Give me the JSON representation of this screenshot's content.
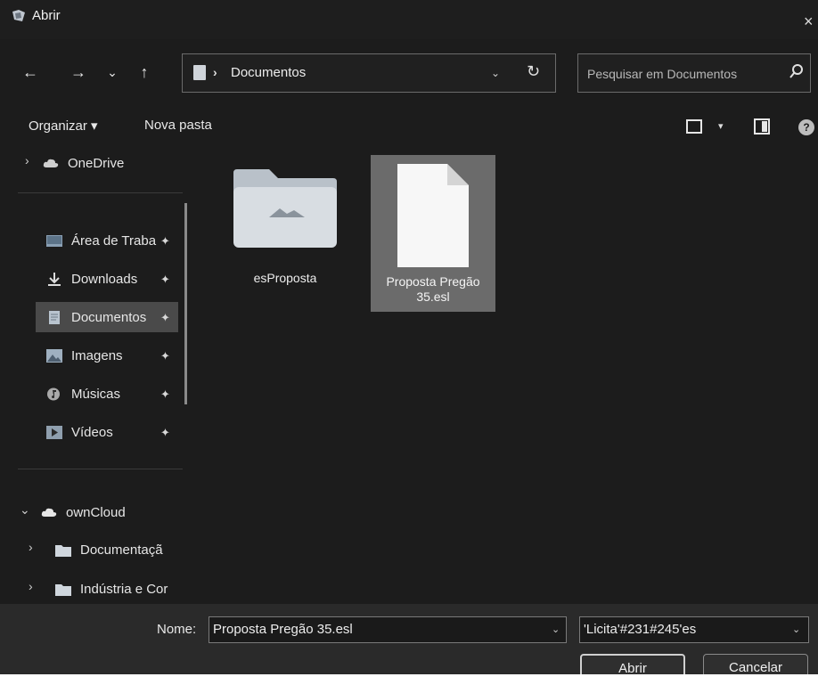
{
  "window": {
    "title": "Abrir",
    "close_glyph": "×"
  },
  "nav": {
    "back_glyph": "←",
    "forward_glyph": "→",
    "recent_glyph": "⌄",
    "up_glyph": "↑"
  },
  "address": {
    "separator": "›",
    "current": "Documentos",
    "chevron": "⌄",
    "refresh_glyph": "↻"
  },
  "search": {
    "placeholder": "Pesquisar em Documentos"
  },
  "toolbar": {
    "organize_label": "Organizar ▾",
    "new_folder_label": "Nova pasta",
    "view_chevron": "▾",
    "help_glyph": "?"
  },
  "sidebar": {
    "expander_right": "›",
    "expander_down": "⌄",
    "pin_glyph": "✦",
    "onedrive": "OneDrive",
    "items": [
      {
        "label": "Área de Traba",
        "icon": "desktop-icon"
      },
      {
        "label": "Downloads",
        "icon": "download-icon"
      },
      {
        "label": "Documentos",
        "icon": "documents-icon"
      },
      {
        "label": "Imagens",
        "icon": "pictures-icon"
      },
      {
        "label": "Músicas",
        "icon": "music-icon"
      },
      {
        "label": "Vídeos",
        "icon": "videos-icon"
      }
    ],
    "owncloud": "ownCloud",
    "owncloud_children": [
      {
        "label": "Documentaçã",
        "icon": "folder-icon"
      },
      {
        "label": "Indústria e Cor",
        "icon": "folder-icon"
      }
    ]
  },
  "files": [
    {
      "name": "esProposta",
      "type": "folder",
      "selected": false
    },
    {
      "name_line1": "Proposta Pregão",
      "name_line2": "35.esl",
      "type": "file",
      "selected": true
    }
  ],
  "bottom": {
    "name_label": "Nome:",
    "name_value": "Proposta Pregão 35.esl",
    "name_chevron": "⌄",
    "filter_value": "'Licita'#231#245'es",
    "filter_chevron": "⌄",
    "open_label": "Abrir",
    "cancel_label": "Cancelar"
  },
  "colors": {
    "background": "#1c1c1c",
    "selection": "#6b6b6b",
    "sidebar_selected": "#4a4a4a",
    "folder": "#d8dde2"
  }
}
